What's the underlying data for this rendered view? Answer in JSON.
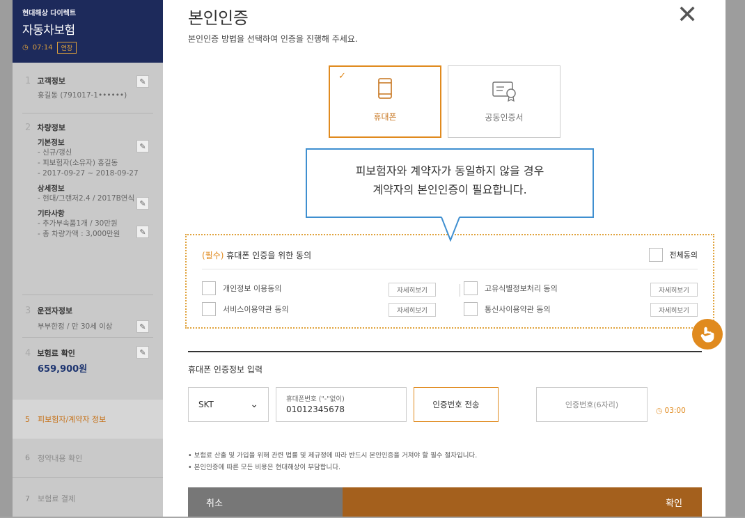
{
  "sidebar": {
    "brand": "현대해상 다이렉트",
    "product": "자동차보험",
    "timer": "07:14",
    "extend_label": "연장",
    "steps": [
      {
        "num": "1",
        "title": "고객정보",
        "lines": [
          "홍길동 (791017-1••••••)"
        ]
      },
      {
        "num": "2",
        "title": "차량정보",
        "groups": [
          {
            "label": "기본정보",
            "lines": [
              "- 신규/갱신",
              "- 피보험자(소유자) 홍길동",
              "- 2017-09-27 ~ 2018-09-27"
            ]
          },
          {
            "label": "상세정보",
            "lines": [
              "- 현대/그랜저2.4 / 2017B연식"
            ]
          },
          {
            "label": "기타사항",
            "lines": [
              "- 추가부속품1개 / 30만원",
              "- 총 차량가액 : 3,000만원"
            ]
          }
        ]
      },
      {
        "num": "3",
        "title": "운전자정보",
        "lines": [
          "부부한정 / 만 30세 이상"
        ]
      },
      {
        "num": "4",
        "title": "보험료 확인",
        "amount": "659,900원"
      },
      {
        "num": "5",
        "title": "피보험자/계약자 정보"
      },
      {
        "num": "6",
        "title": "청약내용 확인"
      },
      {
        "num": "7",
        "title": "보험료 결제"
      }
    ]
  },
  "modal": {
    "title": "본인인증",
    "subtitle": "본인인증 방법을 선택하여 인증을 진행해 주세요.",
    "tabs": [
      {
        "label": "휴대폰"
      },
      {
        "label": "공동인증서"
      }
    ],
    "tooltip": {
      "line1": "피보험자와 계약자가 동일하지 않을 경우",
      "line2": "계약자의 본인인증이 필요합니다."
    },
    "consent": {
      "required_tag": "(필수)",
      "title": "휴대폰 인증을 위한 동의",
      "all_label": "전체동의",
      "more_label": "자세히보기",
      "items": [
        "개인정보 이용동의",
        "고유식별정보처리 동의",
        "서비스이용약관 동의",
        "통신사이용약관 동의"
      ]
    },
    "phone_section": {
      "title": "휴대폰 인증정보 입력",
      "carrier": "SKT",
      "phone_label": "휴대폰번호 (\"-\"없이)",
      "phone_value": "01012345678",
      "send_button": "인증번호 전송",
      "code_placeholder": "인증번호(6자리)",
      "timer": "03:00"
    },
    "notes": [
      "보험료 산출 및 가입을 위해 관련 법률 및 제규정에 따라 반드시 본인인증을 거쳐야 할 필수 절차입니다.",
      "본인인증에 따른 모든 비용은 현대해상이 부담합니다."
    ],
    "cancel": "취소",
    "confirm": "확인"
  }
}
